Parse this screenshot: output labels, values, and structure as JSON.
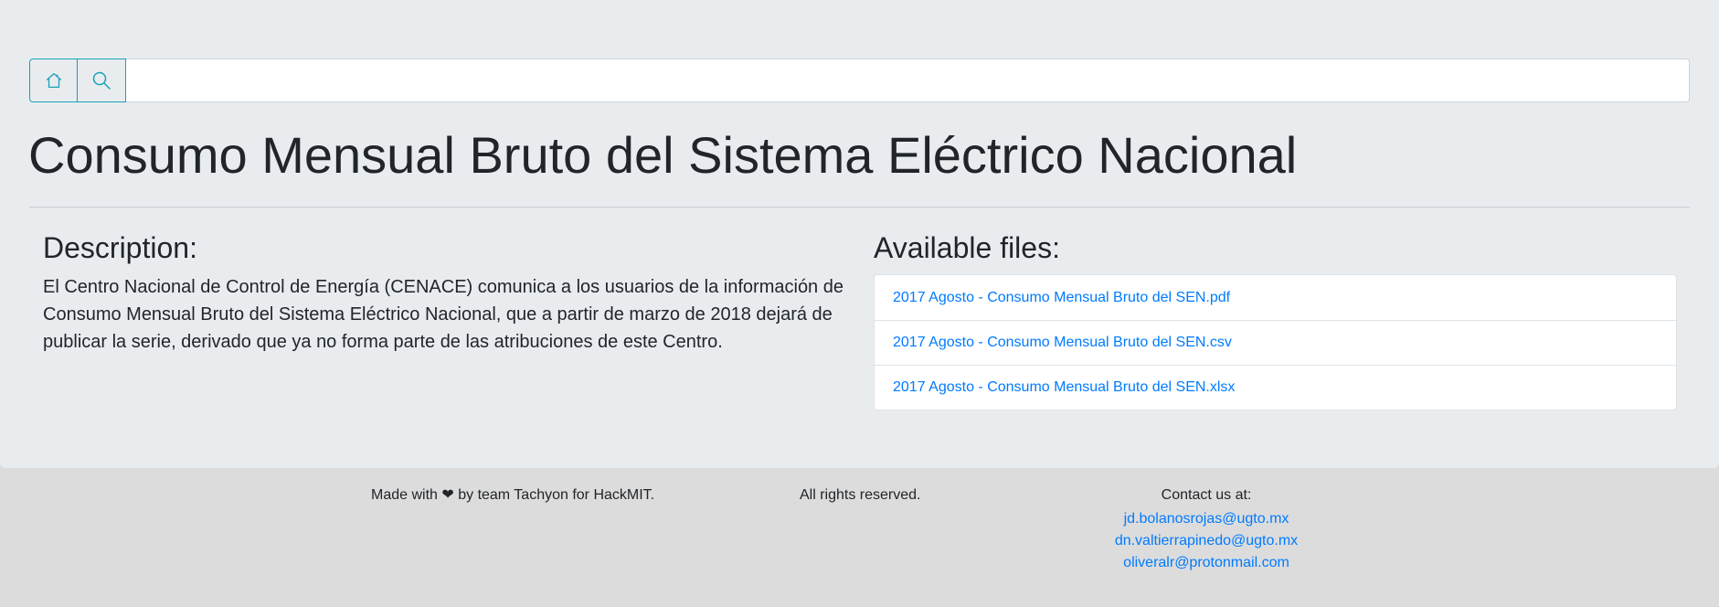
{
  "search": {
    "placeholder": ""
  },
  "icons": {
    "home": "house-icon",
    "search": "magnifier-icon"
  },
  "colors": {
    "accent": "#17a2b8",
    "link": "#007bff",
    "jumbotron": "#e9ecef",
    "footer": "#dcdcdc"
  },
  "page_title": "Consumo Mensual Bruto del Sistema Eléctrico Nacional",
  "description": {
    "heading": "Description:",
    "text": "El Centro Nacional de Control de Energía (CENACE) comunica a los usuarios de la información de Consumo Mensual Bruto del Sistema Eléctrico Nacional, que a partir de marzo de 2018 dejará de publicar la serie, derivado que ya no forma parte de las atribuciones de este Centro."
  },
  "files": {
    "heading": "Available files:",
    "items": [
      "2017 Agosto - Consumo Mensual Bruto del SEN.pdf",
      "2017 Agosto - Consumo Mensual Bruto del SEN.csv",
      "2017 Agosto - Consumo Mensual Bruto del SEN.xlsx"
    ]
  },
  "footer": {
    "made_with": "Made with ❤ by team Tachyon for HackMIT.",
    "rights": "All rights reserved.",
    "contact_label": "Contact us at:",
    "emails": [
      "jd.bolanosrojas@ugto.mx",
      "dn.valtierrapinedo@ugto.mx",
      "oliveralr@protonmail.com"
    ]
  }
}
